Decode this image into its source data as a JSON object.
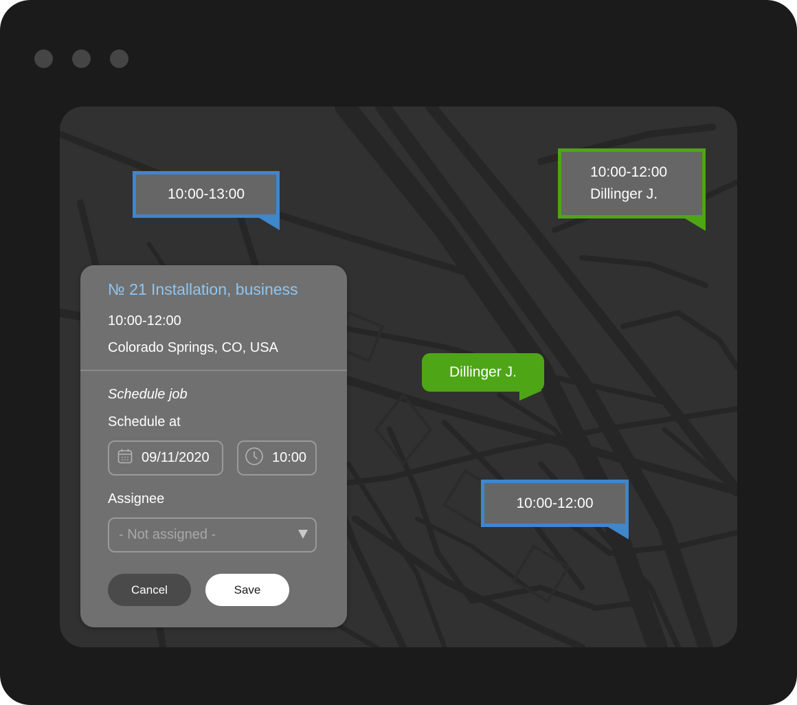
{
  "map_pins": [
    {
      "kind": "blue",
      "lines": [
        "10:00-13:00"
      ]
    },
    {
      "kind": "green",
      "lines": [
        "10:00-12:00",
        "Dillinger J."
      ]
    },
    {
      "kind": "blue",
      "lines": [
        "10:00-12:00"
      ]
    }
  ],
  "technician_bubble": {
    "label": "Dillinger J."
  },
  "job_card": {
    "title": "№ 21 Installation, business",
    "time_window": "10:00-12:00",
    "address": "Colorado Springs, CO, USA",
    "section_title": "Schedule job",
    "schedule_label": "Schedule at",
    "date_value": "09/11/2020",
    "time_value": "10:00",
    "assignee_label": "Assignee",
    "assignee_placeholder": "- Not assigned -",
    "cancel_label": "Cancel",
    "save_label": "Save"
  },
  "icons": {
    "date": "calendar-icon",
    "time": "clock-icon",
    "select": "triangle-down-icon"
  },
  "colors": {
    "window_bg": "#1b1b1b",
    "map_bg": "#313131",
    "map_roads": "#252525",
    "pin_blue": "#3f86cc",
    "pin_green": "#4ea516",
    "card_bg": "#707070",
    "title_blue": "#8ec6f2"
  }
}
